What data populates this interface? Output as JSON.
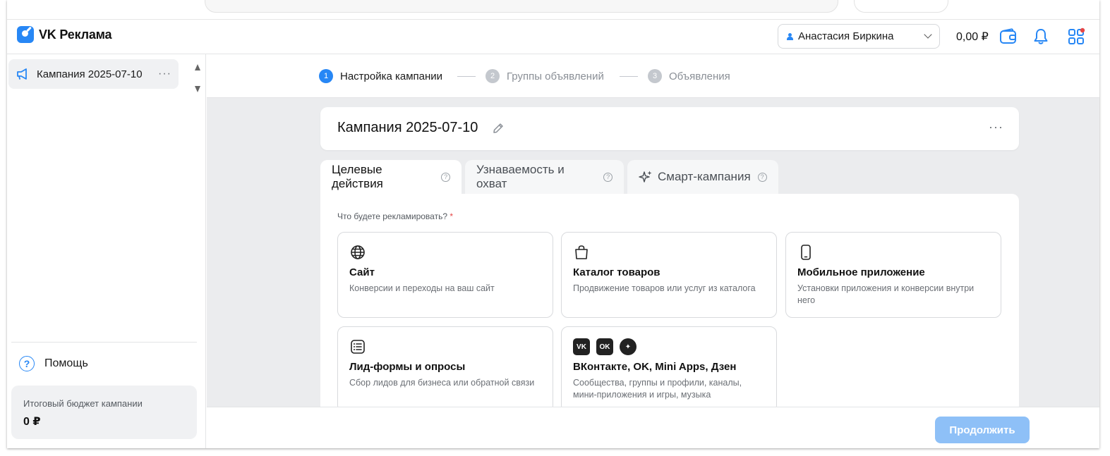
{
  "header": {
    "brand": "VK Реклама",
    "account_name": "Анастасия Биркина",
    "balance": "0,00 ₽"
  },
  "sidebar": {
    "campaign_name": "Кампания 2025-07-10",
    "more": "···",
    "help_label": "Помощь",
    "help_icon": "?",
    "budget_label": "Итоговый бюджет кампании",
    "budget_value": "0 ₽"
  },
  "stepper": {
    "steps": [
      {
        "num": "1",
        "label": "Настройка кампании",
        "state": "active"
      },
      {
        "num": "2",
        "label": "Группы объявлений",
        "state": "inactive"
      },
      {
        "num": "3",
        "label": "Объявления",
        "state": "inactive"
      }
    ]
  },
  "campaign": {
    "title": "Кампания 2025-07-10",
    "more": "···"
  },
  "tabs": [
    {
      "label": "Целевые действия",
      "active": true
    },
    {
      "label": "Узнаваемость и охват",
      "active": false
    },
    {
      "label": "Смарт-кампания",
      "active": false
    }
  ],
  "question": {
    "text": "Что будете рекламировать?",
    "required_mark": "*"
  },
  "options": [
    {
      "icon": "globe-icon",
      "title": "Сайт",
      "desc": "Конверсии и переходы на ваш сайт"
    },
    {
      "icon": "bag-icon",
      "title": "Каталог товаров",
      "desc": "Продвижение товаров или услуг из каталога"
    },
    {
      "icon": "phone-icon",
      "title": "Мобильное приложение",
      "desc": "Установки приложения и конверсии внутри него"
    },
    {
      "icon": "form-icon",
      "title": "Лид-формы и опросы",
      "desc": "Сбор лидов для бизнеса или обратной связи"
    },
    {
      "icon": "social-icons",
      "title": "ВКонтакте, OK, Mini Apps, Дзен",
      "desc": "Сообщества, группы и профили, каналы, мини-приложения и игры, музыка"
    }
  ],
  "social_icon_labels": [
    "VK",
    "OK",
    "✦"
  ],
  "footer": {
    "continue_label": "Продолжить"
  },
  "colors": {
    "accent": "#2787f5",
    "continue_disabled": "#8ec0f7",
    "main_bg": "#ebecee"
  }
}
